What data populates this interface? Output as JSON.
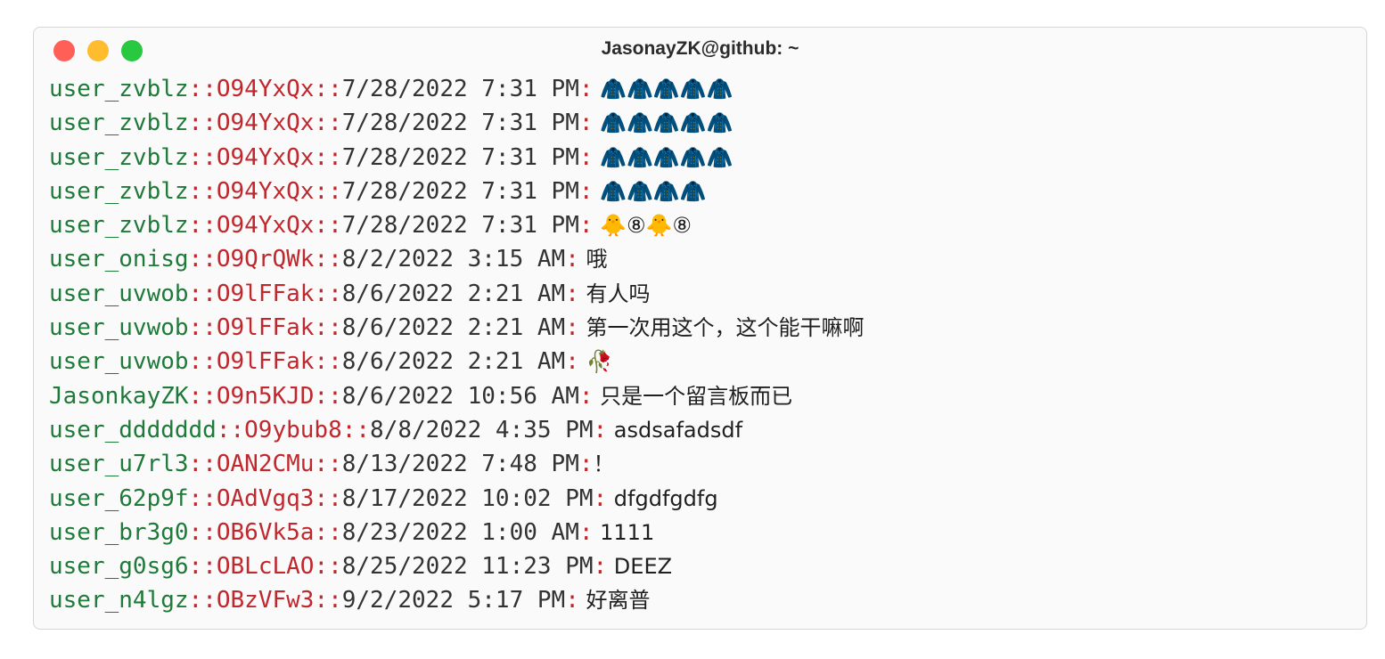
{
  "window": {
    "title": "JasonayZK@github: ~"
  },
  "colors": {
    "username": "#1f7a3a",
    "id": "#c0282d",
    "timestamp": "#333333",
    "traffic_red": "#ff5f57",
    "traffic_yellow": "#febc2e",
    "traffic_green": "#28c840"
  },
  "separator": "::",
  "colon": ":",
  "messages": [
    {
      "user": "user_zvblz",
      "id": "O94YxQx",
      "time": "7/28/2022 7:31 PM",
      "text": " 🧥🧥🧥🧥🧥"
    },
    {
      "user": "user_zvblz",
      "id": "O94YxQx",
      "time": "7/28/2022 7:31 PM",
      "text": " 🧥🧥🧥🧥🧥"
    },
    {
      "user": "user_zvblz",
      "id": "O94YxQx",
      "time": "7/28/2022 7:31 PM",
      "text": " 🧥🧥🧥🧥🧥"
    },
    {
      "user": "user_zvblz",
      "id": "O94YxQx",
      "time": "7/28/2022 7:31 PM",
      "text": " 🧥🧥🧥🧥"
    },
    {
      "user": "user_zvblz",
      "id": "O94YxQx",
      "time": "7/28/2022 7:31 PM",
      "text": " 🐥⑧🐥⑧"
    },
    {
      "user": "user_onisg",
      "id": "O9QrQWk",
      "time": "8/2/2022 3:15 AM",
      "text": " 哦"
    },
    {
      "user": "user_uvwob",
      "id": "O9lFFak",
      "time": "8/6/2022 2:21 AM",
      "text": " 有人吗"
    },
    {
      "user": "user_uvwob",
      "id": "O9lFFak",
      "time": "8/6/2022 2:21 AM",
      "text": " 第一次用这个，这个能干嘛啊"
    },
    {
      "user": "user_uvwob",
      "id": "O9lFFak",
      "time": "8/6/2022 2:21 AM",
      "text": " 🥀"
    },
    {
      "user": "JasonkayZK",
      "id": "O9n5KJD",
      "time": "8/6/2022 10:56 AM",
      "text": " 只是一个留言板而已"
    },
    {
      "user": "user_ddddddd",
      "id": "O9ybub8",
      "time": "8/8/2022 4:35 PM",
      "text": " asdsafadsdf"
    },
    {
      "user": "user_u7rl3",
      "id": "OAN2CMu",
      "time": "8/13/2022 7:48 PM",
      "text": "！"
    },
    {
      "user": "user_62p9f",
      "id": "OAdVgq3",
      "time": "8/17/2022 10:02 PM",
      "text": " dfgdfgdfg"
    },
    {
      "user": "user_br3g0",
      "id": "OB6Vk5a",
      "time": "8/23/2022 1:00 AM",
      "text": " 1111"
    },
    {
      "user": "user_g0sg6",
      "id": "OBLcLAO",
      "time": "8/25/2022 11:23 PM",
      "text": " DEEZ"
    },
    {
      "user": "user_n4lgz",
      "id": "OBzVFw3",
      "time": "9/2/2022 5:17 PM",
      "text": " 好离普"
    }
  ]
}
